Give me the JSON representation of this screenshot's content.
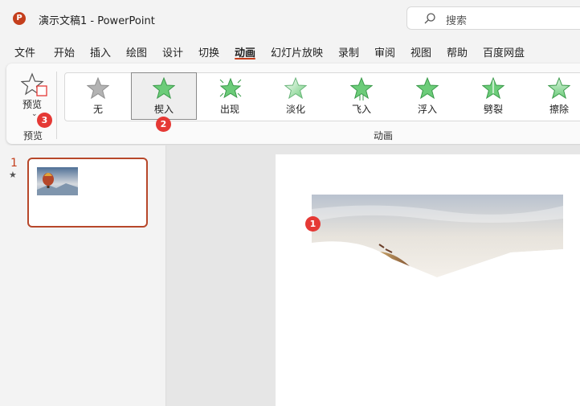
{
  "window": {
    "app_logo_letter": "P",
    "title": "演示文稿1  -  PowerPoint",
    "search_placeholder": "搜索"
  },
  "menu": {
    "items": [
      "文件",
      "开始",
      "插入",
      "绘图",
      "设计",
      "切换",
      "动画",
      "幻灯片放映",
      "录制",
      "审阅",
      "视图",
      "帮助",
      "百度网盘"
    ],
    "active": "动画"
  },
  "ribbon": {
    "preview_button_label": "预览",
    "preview_group_label": "预览",
    "animation_group_label": "动画",
    "animations": [
      {
        "label": "无",
        "icon": "star-gray-icon",
        "selected": false
      },
      {
        "label": "楔入",
        "icon": "star-green-icon",
        "selected": true
      },
      {
        "label": "出现",
        "icon": "star-burst-green-icon",
        "selected": false
      },
      {
        "label": "淡化",
        "icon": "star-faded-green-icon",
        "selected": false
      },
      {
        "label": "飞入",
        "icon": "star-fly-green-icon",
        "selected": false
      },
      {
        "label": "浮入",
        "icon": "star-green-icon",
        "selected": false
      },
      {
        "label": "劈裂",
        "icon": "star-split-green-icon",
        "selected": false
      },
      {
        "label": "擦除",
        "icon": "star-wipe-green-icon",
        "selected": false
      }
    ]
  },
  "badges": [
    "1",
    "2",
    "3"
  ],
  "slides_pane": {
    "slide_number": "1",
    "animation_marker": "★"
  },
  "colors": {
    "accent": "#c43e1c",
    "badge": "#e53935",
    "star_green": "#5cc16b",
    "star_gray": "#a9a9a9"
  }
}
